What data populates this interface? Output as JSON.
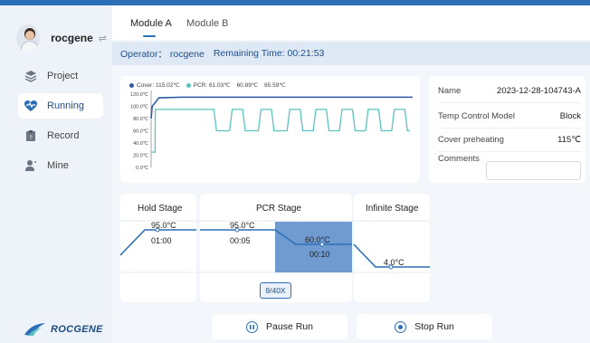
{
  "user": {
    "name": "rocgene",
    "swap_icon": "swap-icon"
  },
  "sidebar": {
    "items": [
      {
        "label": "Project",
        "icon": "layers-icon"
      },
      {
        "label": "Running",
        "icon": "heart-pulse-icon",
        "active": true
      },
      {
        "label": "Record",
        "icon": "clipboard-icon"
      },
      {
        "label": "Mine",
        "icon": "user-icon"
      }
    ],
    "logo_text": "ROCGENE"
  },
  "tabs": [
    {
      "label": "Module A",
      "active": true
    },
    {
      "label": "Module B",
      "active": false
    }
  ],
  "status": {
    "operator": "Operator： rocgene",
    "remaining": "Remaining Time: 00:21:53"
  },
  "legend": {
    "cover": "Cover: 115.02℃",
    "pcr": "PCR: 61.03℃",
    "extra1": "60.89℃",
    "extra2": "65.59℃"
  },
  "colors": {
    "accent": "#2c6fb7",
    "cover_line": "#2e5aa8",
    "pcr_line": "#5bc4c0",
    "pcr_highlight": "#6f9bd0"
  },
  "chart_data": {
    "type": "line",
    "title": "",
    "xlabel": "",
    "ylabel": "",
    "ylim": [
      0,
      120
    ],
    "yticks": [
      "120.0℃",
      "100.0℃",
      "80.0℃",
      "60.0℃",
      "40.0℃",
      "20.0℃",
      "0.0℃"
    ],
    "grid": false,
    "legend_position": "top-left",
    "series": [
      {
        "name": "Cover",
        "x": [
          0,
          0.4,
          3,
          12,
          25,
          50,
          75,
          100
        ],
        "values": [
          80,
          100,
          114,
          115,
          115,
          115,
          115,
          115
        ]
      },
      {
        "name": "PCR",
        "x": [
          0,
          1.5,
          1.6,
          2,
          24,
          25,
          26,
          30,
          31,
          32,
          35,
          36,
          37,
          41,
          42,
          43,
          46,
          47,
          48,
          52,
          53,
          54,
          57,
          58,
          59,
          62,
          63,
          64,
          67,
          68,
          69,
          72,
          73,
          74,
          77,
          78,
          79,
          82,
          83,
          84,
          87,
          88,
          89,
          92,
          93,
          94,
          97,
          98,
          99
        ],
        "values": [
          25,
          25,
          95,
          95,
          95,
          60,
          60,
          60,
          95,
          95,
          95,
          60,
          60,
          60,
          95,
          95,
          95,
          60,
          60,
          60,
          95,
          95,
          95,
          60,
          60,
          60,
          95,
          95,
          95,
          60,
          60,
          60,
          95,
          95,
          95,
          60,
          60,
          60,
          95,
          95,
          95,
          60,
          60,
          60,
          95,
          95,
          95,
          60,
          60
        ]
      }
    ]
  },
  "info": {
    "name_label": "Name",
    "name_value": "2023-12-28-104743-A",
    "temp_label": "Temp Control Model",
    "temp_value": "Block",
    "cover_label": "Cover preheating",
    "cover_value": "115℃",
    "comments_label": "Comments",
    "comments_value": ""
  },
  "stages": {
    "hold": {
      "title": "Hold Stage",
      "temp": "95.0°C",
      "time": "01:00"
    },
    "pcr": {
      "title": "PCR Stage",
      "step1_temp": "95.0°C",
      "step1_time": "00:05",
      "step2_temp": "60.0°C",
      "step2_time": "00:10",
      "cycles": "9/40X"
    },
    "infinite": {
      "title": "Infinite Stage",
      "temp": "4.0°C"
    }
  },
  "actions": {
    "pause": "Pause Run",
    "stop": "Stop Run"
  }
}
